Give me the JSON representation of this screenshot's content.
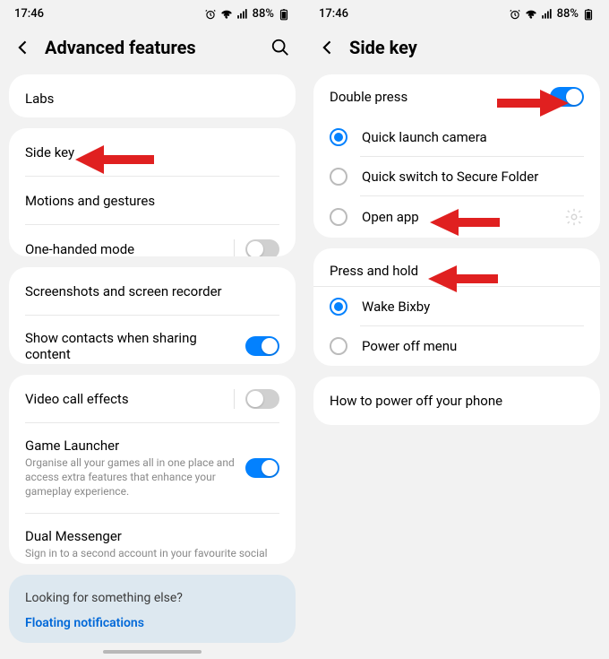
{
  "left": {
    "status": {
      "time": "17:46",
      "battery": "88%"
    },
    "header": {
      "title": "Advanced features"
    },
    "labs": "Labs",
    "sideKey": "Side key",
    "motions": "Motions and gestures",
    "oneHanded": "One-handed mode",
    "screenshots": "Screenshots and screen recorder",
    "showContacts": "Show contacts when sharing content",
    "videoCall": "Video call effects",
    "gameLauncher": {
      "title": "Game Launcher",
      "sub": "Organise all your games all in one place and access extra features that enhance your gameplay experience."
    },
    "dualMessenger": {
      "title": "Dual Messenger",
      "sub": "Sign in to a second account in your favourite social apps."
    },
    "footer": {
      "title": "Looking for something else?",
      "link": "Floating notifications"
    }
  },
  "right": {
    "status": {
      "time": "17:46",
      "battery": "88%"
    },
    "header": {
      "title": "Side key"
    },
    "doublePress": "Double press",
    "quickCamera": "Quick launch camera",
    "quickSecure": "Quick switch to Secure Folder",
    "openApp": "Open app",
    "pressHold": "Press and hold",
    "wakeBixby": "Wake Bixby",
    "powerOff": "Power off menu",
    "howTo": "How to power off your phone"
  }
}
